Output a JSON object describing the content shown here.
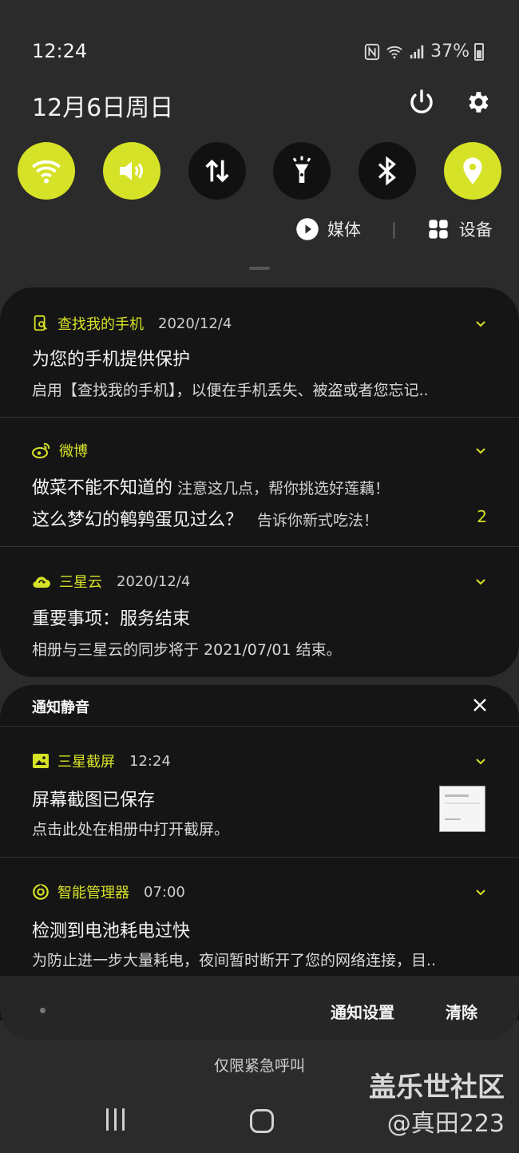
{
  "status_bar": {
    "time": "12:24",
    "battery": "37%"
  },
  "header": {
    "date": "12月6日周日"
  },
  "quick_toggles": [
    {
      "name": "wifi",
      "icon": "wifi-icon",
      "on": true
    },
    {
      "name": "sound",
      "icon": "sound-icon",
      "on": true
    },
    {
      "name": "mobile-data",
      "icon": "mobile-data-icon",
      "on": false
    },
    {
      "name": "flashlight",
      "icon": "flashlight-icon",
      "on": false
    },
    {
      "name": "bluetooth",
      "icon": "bluetooth-icon",
      "on": false
    },
    {
      "name": "location",
      "icon": "location-icon",
      "on": true
    }
  ],
  "media_row": {
    "media_label": "媒体",
    "separator": "|",
    "devices_label": "设备"
  },
  "notifications": [
    {
      "app": "查找我的手机",
      "time": "2020/12/4",
      "title": "为您的手机提供保护",
      "body": "启用【查找我的手机】，以便在手机丢失、被盗或者您忘记.."
    },
    {
      "app": "微博",
      "line1_title": "做菜不能不知道的",
      "line1_sub": "注意这几点，帮你挑选好莲藕！",
      "line2_title": "这么梦幻的鹌鹑蛋见过么？",
      "line2_sub": "告诉你新式吃法！",
      "count": "2"
    },
    {
      "app": "三星云",
      "time": "2020/12/4",
      "title": "重要事项：服务结束",
      "body": "相册与三星云的同步将于 2021/07/01 结束。"
    }
  ],
  "silent_section": {
    "label": "通知静音",
    "items": [
      {
        "app": "三星截屏",
        "time": "12:24",
        "title": "屏幕截图已保存",
        "body": "点击此处在相册中打开截屏。"
      },
      {
        "app": "智能管理器",
        "time": "07:00",
        "title": "检测到电池耗电过快",
        "body": "为防止进一步大量耗电，夜间暂时断开了您的网络连接，目.."
      }
    ]
  },
  "footer": {
    "settings_label": "通知设置",
    "clear_label": "清除",
    "emergency_text": "仅限紧急呼叫"
  },
  "watermark": {
    "line1": "盖乐世社区",
    "line2": "@真田223"
  },
  "colors": {
    "accent": "#d6e227",
    "card_bg": "#151515",
    "panel_bg": "#2b2b2b"
  }
}
